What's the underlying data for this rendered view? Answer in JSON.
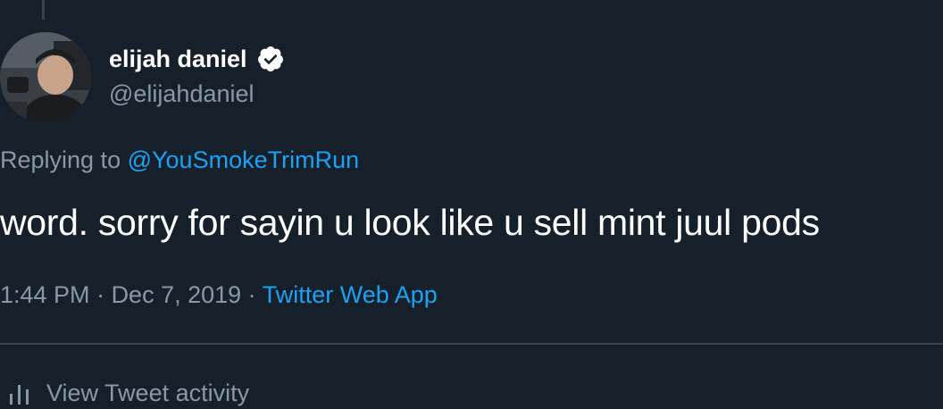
{
  "author": {
    "display_name": "elijah daniel",
    "handle": "@elijahdaniel",
    "verified_icon": "verified-badge-icon",
    "avatar_icon": "profile-photo"
  },
  "reply": {
    "prefix": "Replying to ",
    "mention": "@YouSmokeTrimRun"
  },
  "tweet": {
    "text": "word. sorry for sayin u look like u sell mint juul pods"
  },
  "meta": {
    "time": "1:44 PM",
    "separator": " · ",
    "date": "Dec 7, 2019",
    "source": "Twitter Web App"
  },
  "footer": {
    "activity_label": "View Tweet activity",
    "activity_icon": "bar-chart-icon"
  },
  "colors": {
    "background": "#15202b",
    "text_primary": "#ffffff",
    "text_secondary": "#8899a6",
    "accent": "#1da1f2",
    "divider": "#38444d"
  }
}
